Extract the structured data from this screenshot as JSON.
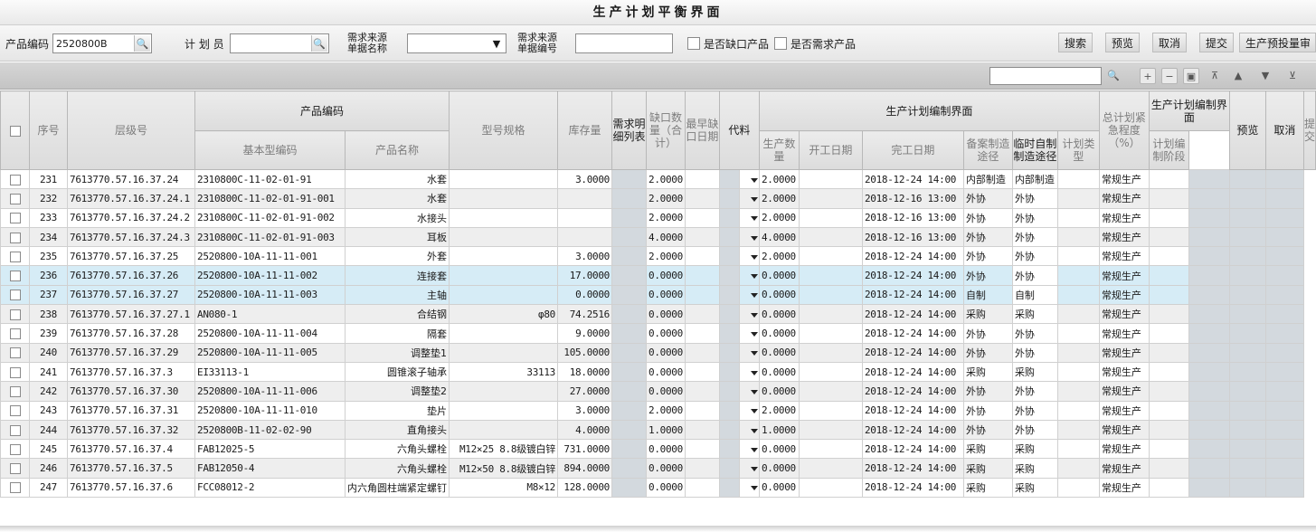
{
  "window": {
    "title": "生产计划平衡界面"
  },
  "filters": {
    "product_code_label": "产品编码",
    "product_code_value": "2520800B",
    "planner_label": "计 划 员",
    "planner_value": "",
    "source_doc_name_label_1": "需求来源",
    "source_doc_name_label_2": "单据名称",
    "source_doc_name_value": "",
    "source_doc_no_label_1": "需求来源",
    "source_doc_no_label_2": "单据编号",
    "source_doc_no_value": "",
    "missing_label": "是否缺口产品",
    "demand_label": "是否需求产品"
  },
  "toolbar": {
    "search": "搜索",
    "preview": "预览",
    "cancel": "取消",
    "submit": "提交",
    "pre_commit": "生产预投量审"
  },
  "grid_toolbar": {
    "search_value": "",
    "icons": [
      "search-icon",
      "add-icon",
      "remove-icon",
      "edit-icon",
      "first-icon",
      "up-icon",
      "down-icon",
      "last-icon"
    ]
  },
  "headers": {
    "seq": "序号",
    "level": "层级号",
    "product_code": "产品编码",
    "base_code": "基本型编码",
    "product_name": "产品名称",
    "spec": "型号规格",
    "stock": "库存量",
    "demand_detail": "需求明细列表",
    "shortage_qty": "缺口数量（合计）",
    "earliest_date": "最早缺口日期",
    "substitute": "代料",
    "plan_group": "生产计划编制界面",
    "prod_qty": "生产数量",
    "start_date": "开工日期",
    "finish_date": "完工日期",
    "filed_route": "备案制造途径",
    "temp_route": "临时自制制造途径",
    "urgency": "总计划紧急程度（%）",
    "plan_group2": "生产计划编制界面",
    "plan_type": "计划类型",
    "plan_stage": "计划编制阶段",
    "preview": "预览",
    "cancel": "取消",
    "submit": "提交"
  },
  "rows": [
    {
      "seq": "231",
      "level": "7613770.57.16.37.24",
      "base": "2310800C-11-02-01-91",
      "name": "水套",
      "spec": "",
      "stock": "3.0000",
      "shortage": "2.0000",
      "prod": "2.0000",
      "finish": "2018-12-24 14:00",
      "filed": "内部制造",
      "temp": "内部制造",
      "ptype": "常规生产"
    },
    {
      "seq": "232",
      "level": "7613770.57.16.37.24.1",
      "base": "2310800C-11-02-01-91-001",
      "name": "水套",
      "spec": "",
      "stock": "",
      "shortage": "2.0000",
      "prod": "2.0000",
      "finish": "2018-12-16 13:00",
      "filed": "外协",
      "temp": "外协",
      "ptype": "常规生产"
    },
    {
      "seq": "233",
      "level": "7613770.57.16.37.24.2",
      "base": "2310800C-11-02-01-91-002",
      "name": "水接头",
      "spec": "",
      "stock": "",
      "shortage": "2.0000",
      "prod": "2.0000",
      "finish": "2018-12-16 13:00",
      "filed": "外协",
      "temp": "外协",
      "ptype": "常规生产"
    },
    {
      "seq": "234",
      "level": "7613770.57.16.37.24.3",
      "base": "2310800C-11-02-01-91-003",
      "name": "耳板",
      "spec": "",
      "stock": "",
      "shortage": "4.0000",
      "prod": "4.0000",
      "finish": "2018-12-16 13:00",
      "filed": "外协",
      "temp": "外协",
      "ptype": "常规生产"
    },
    {
      "seq": "235",
      "level": "7613770.57.16.37.25",
      "base": "2520800-10A-11-11-001",
      "name": "外套",
      "spec": "",
      "stock": "3.0000",
      "shortage": "2.0000",
      "prod": "2.0000",
      "finish": "2018-12-24 14:00",
      "filed": "外协",
      "temp": "外协",
      "ptype": "常规生产"
    },
    {
      "seq": "236",
      "level": "7613770.57.16.37.26",
      "base": "2520800-10A-11-11-002",
      "name": "连接套",
      "spec": "",
      "stock": "17.0000",
      "shortage": "0.0000",
      "prod": "0.0000",
      "finish": "2018-12-24 14:00",
      "filed": "外协",
      "temp": "外协",
      "ptype": "常规生产"
    },
    {
      "seq": "237",
      "level": "7613770.57.16.37.27",
      "base": "2520800-10A-11-11-003",
      "name": "主轴",
      "spec": "",
      "stock": "0.0000",
      "shortage": "0.0000",
      "prod": "0.0000",
      "finish": "2018-12-24 14:00",
      "filed": "自制",
      "temp": "自制",
      "ptype": "常规生产"
    },
    {
      "seq": "238",
      "level": "7613770.57.16.37.27.1",
      "base": "AN080-1",
      "name": "合结钢",
      "spec": "φ80",
      "stock": "74.2516",
      "shortage": "0.0000",
      "prod": "0.0000",
      "finish": "2018-12-24 14:00",
      "filed": "采购",
      "temp": "采购",
      "ptype": "常规生产"
    },
    {
      "seq": "239",
      "level": "7613770.57.16.37.28",
      "base": "2520800-10A-11-11-004",
      "name": "隔套",
      "spec": "",
      "stock": "9.0000",
      "shortage": "0.0000",
      "prod": "0.0000",
      "finish": "2018-12-24 14:00",
      "filed": "外协",
      "temp": "外协",
      "ptype": "常规生产"
    },
    {
      "seq": "240",
      "level": "7613770.57.16.37.29",
      "base": "2520800-10A-11-11-005",
      "name": "调整垫1",
      "spec": "",
      "stock": "105.0000",
      "shortage": "0.0000",
      "prod": "0.0000",
      "finish": "2018-12-24 14:00",
      "filed": "外协",
      "temp": "外协",
      "ptype": "常规生产"
    },
    {
      "seq": "241",
      "level": "7613770.57.16.37.3",
      "base": "EI33113-1",
      "name": "圆锥滚子轴承",
      "spec": "33113",
      "stock": "18.0000",
      "shortage": "0.0000",
      "prod": "0.0000",
      "finish": "2018-12-24 14:00",
      "filed": "采购",
      "temp": "采购",
      "ptype": "常规生产"
    },
    {
      "seq": "242",
      "level": "7613770.57.16.37.30",
      "base": "2520800-10A-11-11-006",
      "name": "调整垫2",
      "spec": "",
      "stock": "27.0000",
      "shortage": "0.0000",
      "prod": "0.0000",
      "finish": "2018-12-24 14:00",
      "filed": "外协",
      "temp": "外协",
      "ptype": "常规生产"
    },
    {
      "seq": "243",
      "level": "7613770.57.16.37.31",
      "base": "2520800-10A-11-11-010",
      "name": "垫片",
      "spec": "",
      "stock": "3.0000",
      "shortage": "2.0000",
      "prod": "2.0000",
      "finish": "2018-12-24 14:00",
      "filed": "外协",
      "temp": "外协",
      "ptype": "常规生产"
    },
    {
      "seq": "244",
      "level": "7613770.57.16.37.32",
      "base": "2520800B-11-02-02-90",
      "name": "直角接头",
      "spec": "",
      "stock": "4.0000",
      "shortage": "1.0000",
      "prod": "1.0000",
      "finish": "2018-12-24 14:00",
      "filed": "外协",
      "temp": "外协",
      "ptype": "常规生产"
    },
    {
      "seq": "245",
      "level": "7613770.57.16.37.4",
      "base": "FAB12025-5",
      "name": "六角头螺栓",
      "spec": "M12×25 8.8级镀白锌",
      "stock": "731.0000",
      "shortage": "0.0000",
      "prod": "0.0000",
      "finish": "2018-12-24 14:00",
      "filed": "采购",
      "temp": "采购",
      "ptype": "常规生产"
    },
    {
      "seq": "246",
      "level": "7613770.57.16.37.5",
      "base": "FAB12050-4",
      "name": "六角头螺栓",
      "spec": "M12×50 8.8级镀白锌",
      "stock": "894.0000",
      "shortage": "0.0000",
      "prod": "0.0000",
      "finish": "2018-12-24 14:00",
      "filed": "采购",
      "temp": "采购",
      "ptype": "常规生产"
    },
    {
      "seq": "247",
      "level": "7613770.57.16.37.6",
      "base": "FCC08012-2",
      "name": "内六角圆柱端紧定螺钉",
      "spec": "M8×12",
      "stock": "128.0000",
      "shortage": "0.0000",
      "prod": "0.0000",
      "finish": "2018-12-24 14:00",
      "filed": "采购",
      "temp": "采购",
      "ptype": "常规生产"
    }
  ]
}
